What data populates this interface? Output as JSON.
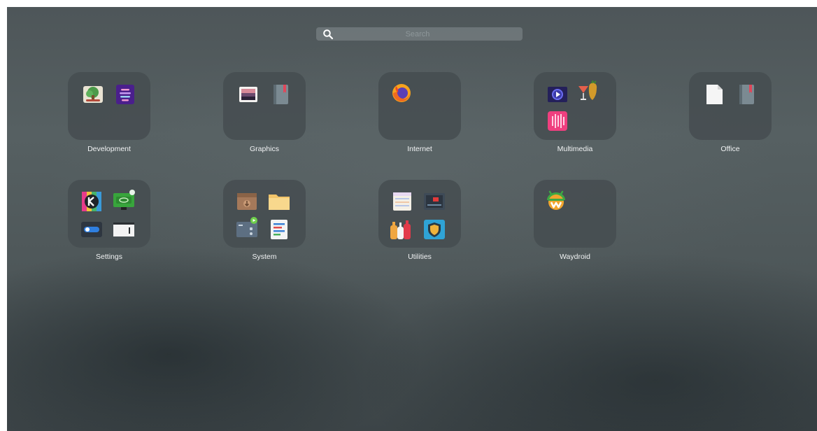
{
  "search": {
    "placeholder": "Search",
    "icon": "search-icon"
  },
  "folders": [
    {
      "label": "Development",
      "icons": [
        "tree-app-icon",
        "text-lines-app-icon"
      ]
    },
    {
      "label": "Graphics",
      "icons": [
        "image-viewer-icon",
        "book-icon"
      ]
    },
    {
      "label": "Internet",
      "icons": [
        "firefox-icon"
      ]
    },
    {
      "label": "Multimedia",
      "icons": [
        "video-player-icon",
        "cocktail-icon",
        "audio-grid-icon"
      ]
    },
    {
      "label": "Office",
      "icons": [
        "document-icon",
        "book-icon"
      ]
    },
    {
      "label": "Settings",
      "icons": [
        "kde-settings-icon",
        "gpu-settings-icon",
        "toggle-switch-icon",
        "window-icon"
      ]
    },
    {
      "label": "System",
      "icons": [
        "package-box-icon",
        "folder-icon",
        "media-box-icon",
        "checklist-icon"
      ]
    },
    {
      "label": "Utilities",
      "icons": [
        "notes-icon",
        "screen-recorder-icon",
        "bottles-icon",
        "shield-icon"
      ]
    },
    {
      "label": "Waydroid",
      "icons": [
        "waydroid-icon"
      ]
    }
  ],
  "colors": {
    "tile": "#464e51",
    "label_text": "#f1f3f4",
    "search_field": "#8f979b"
  }
}
